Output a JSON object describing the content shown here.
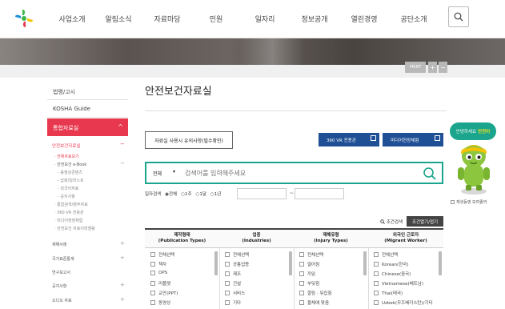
{
  "header": {
    "menu": [
      "사업소개",
      "알림소식",
      "자료마당",
      "민원",
      "일자리",
      "정보공개",
      "열린경영",
      "공단소개"
    ],
    "logo_icon": "kosha-logo-icon",
    "search_icon": "search-icon"
  },
  "toolbar": {
    "print": "PRINT",
    "plus": "+",
    "minus": "−"
  },
  "sidebar": {
    "items_top": [
      "법령/고시",
      "KOSHA Guide"
    ],
    "active": "통합자료실",
    "active_chevron": "^",
    "sub": [
      {
        "label": "안전보건자료실",
        "style": "red",
        "mark": "−"
      },
      {
        "label": "· 전체자료보기",
        "style": "red",
        "mark": ""
      },
      {
        "label": "· 안전보건 e-Book",
        "style": "dark",
        "mark": "−"
      },
      {
        "label": "- 동영상콘텐츠",
        "style": "light",
        "mark": ""
      },
      {
        "label": "- 삽화/일러스트",
        "style": "light",
        "mark": ""
      },
      {
        "label": "- 외국어자료",
        "style": "light",
        "mark": ""
      },
      {
        "label": "- 공지사항",
        "style": "light",
        "mark": ""
      },
      {
        "label": "· 통합검색/첨부자료",
        "style": "light",
        "mark": ""
      },
      {
        "label": "· 360 VR 전용관",
        "style": "light",
        "mark": ""
      },
      {
        "label": "· 미디어현장체험",
        "style": "light",
        "mark": ""
      },
      {
        "label": "· 안전보건 자료이력열람",
        "style": "light",
        "mark": ""
      }
    ],
    "items_bottom": [
      {
        "label": "재해사례",
        "mark": "+"
      },
      {
        "label": "국가표준통계",
        "mark": "+"
      },
      {
        "label": "연구보고서",
        "mark": ""
      },
      {
        "label": "공지사항",
        "mark": "+"
      },
      {
        "label": "오디오 자료",
        "mark": "+"
      }
    ]
  },
  "main": {
    "title": "안전보건자료실",
    "notice_button": "자료실 사용시 유의사항(필수확인)",
    "vr_button": "360 VR 전용관",
    "media_button": "미디어현장체험",
    "search": {
      "category": "전체",
      "caret": "▾",
      "placeholder": "검색어를 입력해주세요"
    },
    "date": {
      "label": "일자검색",
      "options": [
        "◉전체",
        "○1주",
        "○1달",
        "○1년"
      ],
      "dash": "~"
    },
    "condition_search": "조건검색",
    "condition_toggle": "조건열기/접기",
    "filters": [
      {
        "header": "제작형태\n(Publication Types)",
        "items": [
          "전체선택",
          "책자",
          "OPS",
          "리플렛",
          "교안(PPT)",
          "동영상"
        ]
      },
      {
        "header": "업종\n(Industries)",
        "items": [
          "전체선택",
          "공통업종",
          "제조",
          "건설",
          "서비스",
          "기타"
        ]
      },
      {
        "header": "재해유형\n(Injury Types)",
        "items": [
          "전체선택",
          "떨어짐",
          "끼임",
          "부딪힘",
          "깔림 · 뒤집힘",
          "물체에 맞음"
        ]
      },
      {
        "header": "외국인 근로자\n(Migrant Worker)",
        "items": [
          "전체선택",
          "Korean(한국)",
          "Chinese(중국)",
          "Vietnamese(베트남)",
          "Thai(태국)",
          "Uzbek(우즈베키스탄)/기타"
        ]
      }
    ]
  },
  "mascot": {
    "bubble_text": "안녕하세요",
    "bubble_highlight": "안전이",
    "label": "재생동영 보여줄까"
  },
  "colors": {
    "accent_red": "#e8384f",
    "button_blue": "#1f4f95",
    "search_green": "#1aa58c"
  }
}
